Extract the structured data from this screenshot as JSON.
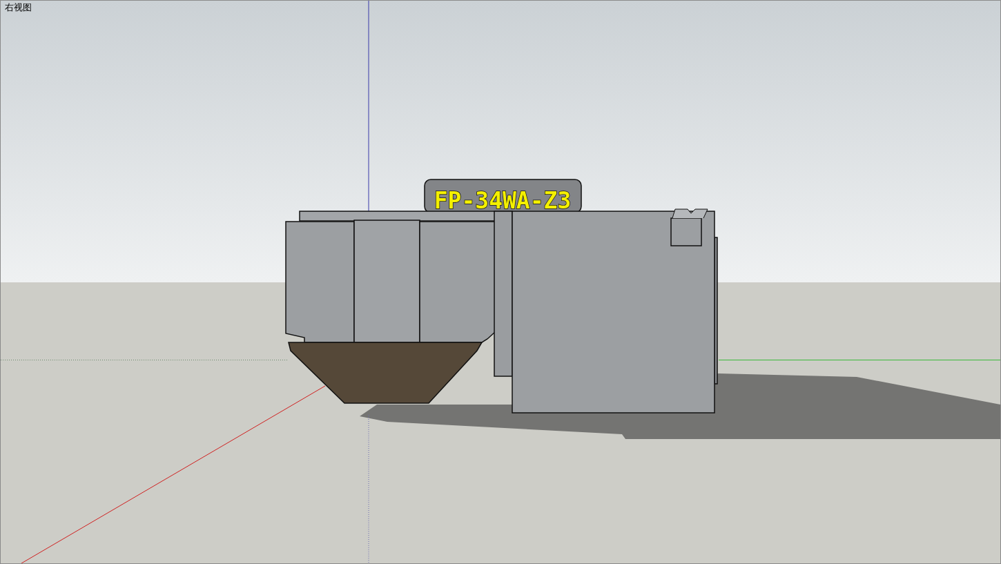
{
  "view": {
    "title": "右视图"
  },
  "model": {
    "sign_text": "FP-34WA-Z3"
  }
}
